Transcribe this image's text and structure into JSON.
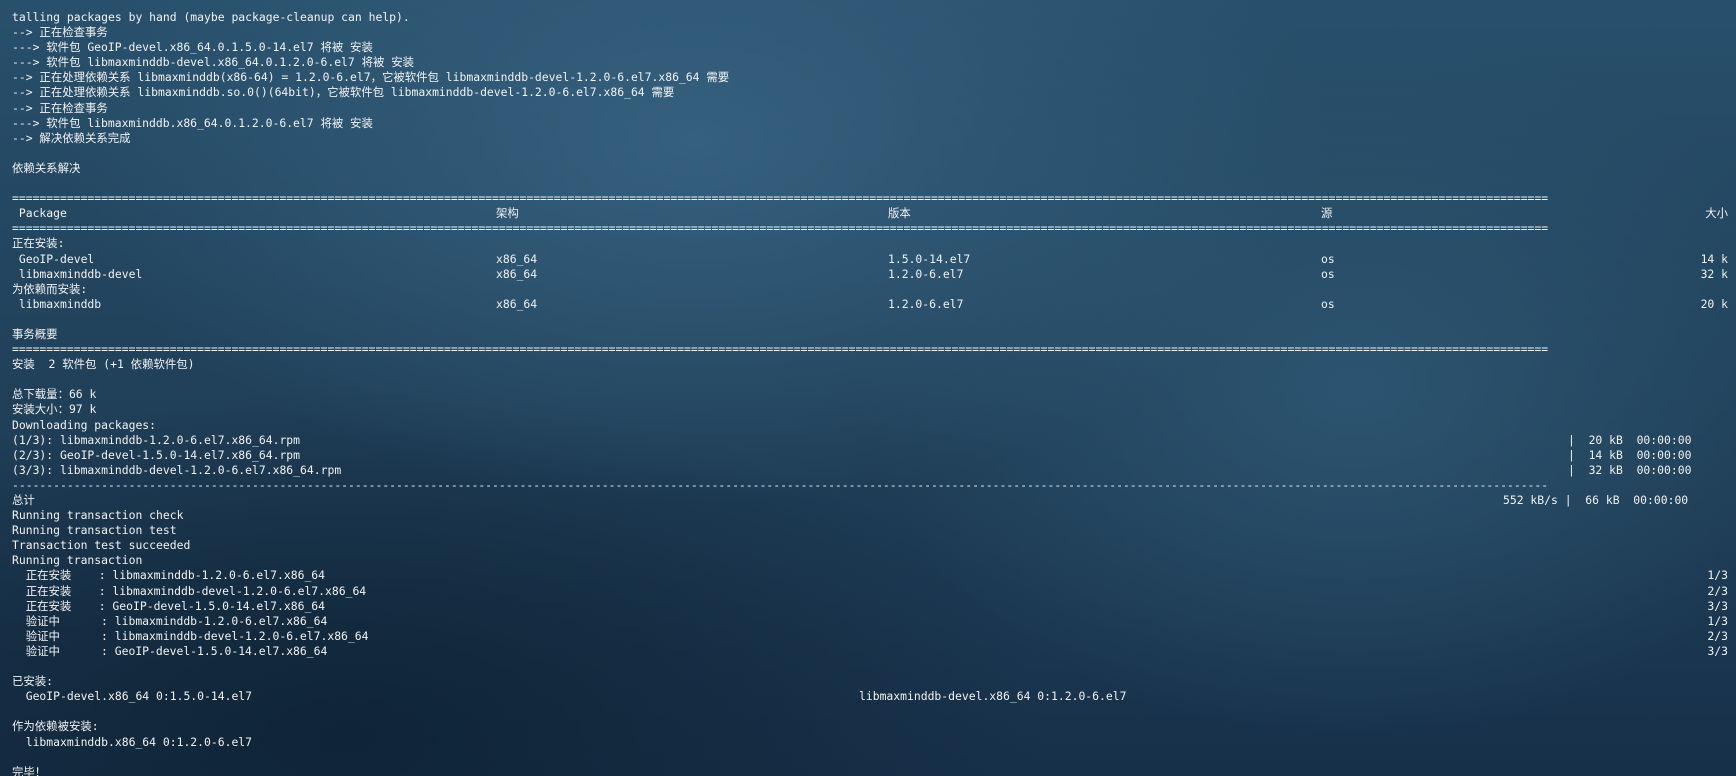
{
  "log_top": [
    "talling packages by hand (maybe package-cleanup can help).",
    "--> 正在检查事务",
    "---> 软件包 GeoIP-devel.x86_64.0.1.5.0-14.el7 将被 安装",
    "---> 软件包 libmaxminddb-devel.x86_64.0.1.2.0-6.el7 将被 安装",
    "--> 正在处理依赖关系 libmaxminddb(x86-64) = 1.2.0-6.el7，它被软件包 libmaxminddb-devel-1.2.0-6.el7.x86_64 需要",
    "--> 正在处理依赖关系 libmaxminddb.so.0()(64bit)，它被软件包 libmaxminddb-devel-1.2.0-6.el7.x86_64 需要",
    "--> 正在检查事务",
    "---> 软件包 libmaxminddb.x86_64.0.1.2.0-6.el7 将被 安装",
    "--> 解决依赖关系完成"
  ],
  "resolved_heading": "依赖关系解决",
  "table": {
    "headers": {
      "package": " Package",
      "arch": "架构",
      "version": "版本",
      "repo": "源",
      "size": "大小"
    },
    "group_installing": "正在安装:",
    "group_deps": "为依赖而安装:",
    "rows_installing": [
      {
        "package": " GeoIP-devel",
        "arch": "x86_64",
        "version": "1.5.0-14.el7",
        "repo": "os",
        "size": "14 k"
      },
      {
        "package": " libmaxminddb-devel",
        "arch": "x86_64",
        "version": "1.2.0-6.el7",
        "repo": "os",
        "size": "32 k"
      }
    ],
    "rows_deps": [
      {
        "package": " libmaxminddb",
        "arch": "x86_64",
        "version": "1.2.0-6.el7",
        "repo": "os",
        "size": "20 k"
      }
    ]
  },
  "summary": {
    "heading": "事务概要",
    "install_line": "安装  2 软件包 (+1 依赖软件包)",
    "total_download": "总下载量：66 k",
    "install_size": "安装大小：97 k",
    "downloading": "Downloading packages:"
  },
  "downloads": [
    {
      "name": "(1/3): libmaxminddb-1.2.0-6.el7.x86_64.rpm",
      "stats": "|  20 kB  00:00:00"
    },
    {
      "name": "(2/3): GeoIP-devel-1.5.0-14.el7.x86_64.rpm",
      "stats": "|  14 kB  00:00:00"
    },
    {
      "name": "(3/3): libmaxminddb-devel-1.2.0-6.el7.x86_64.rpm",
      "stats": "|  32 kB  00:00:00"
    }
  ],
  "total": {
    "label": "总计",
    "stats": "552 kB/s |  66 kB  00:00:00"
  },
  "transaction_lines": [
    "Running transaction check",
    "Running transaction test",
    "Transaction test succeeded",
    "Running transaction"
  ],
  "steps": [
    {
      "text": "  正在安装    : libmaxminddb-1.2.0-6.el7.x86_64",
      "count": "1/3"
    },
    {
      "text": "  正在安装    : libmaxminddb-devel-1.2.0-6.el7.x86_64",
      "count": "2/3"
    },
    {
      "text": "  正在安装    : GeoIP-devel-1.5.0-14.el7.x86_64",
      "count": "3/3"
    },
    {
      "text": "  验证中      : libmaxminddb-1.2.0-6.el7.x86_64",
      "count": "1/3"
    },
    {
      "text": "  验证中      : libmaxminddb-devel-1.2.0-6.el7.x86_64",
      "count": "2/3"
    },
    {
      "text": "  验证中      : GeoIP-devel-1.5.0-14.el7.x86_64",
      "count": "3/3"
    }
  ],
  "installed": {
    "heading": "已安装:",
    "left": "  GeoIP-devel.x86_64 0:1.5.0-14.el7",
    "right": "libmaxminddb-devel.x86_64 0:1.2.0-6.el7"
  },
  "dep_installed": {
    "heading": "作为依赖被安装:",
    "item": "  libmaxminddb.x86_64 0:1.2.0-6.el7"
  },
  "done": "完毕！",
  "separators": {
    "double": "================================================================================================================================================================================================================================",
    "single": "--------------------------------------------------------------------------------------------------------------------------------------------------------------------------------------------------------------------------------"
  }
}
